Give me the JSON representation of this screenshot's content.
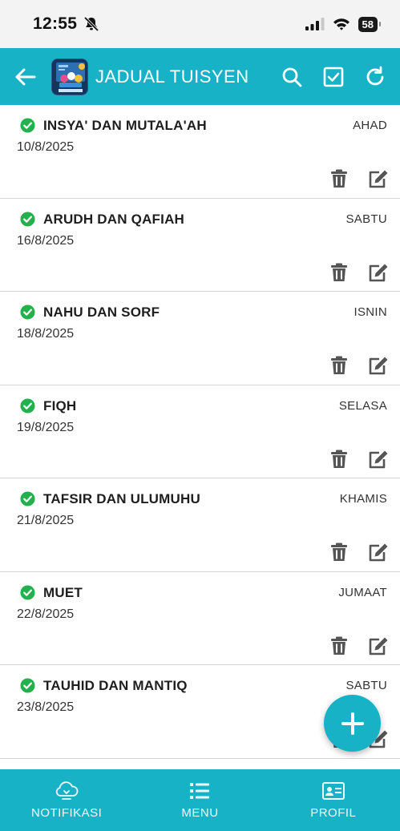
{
  "status_bar": {
    "time": "12:55",
    "battery": "58"
  },
  "app_bar": {
    "title": "JADUAL TUISYEN",
    "back_icon": "arrow-left-icon",
    "search_icon": "search-icon",
    "select_icon": "checkbox-icon",
    "refresh_icon": "refresh-icon"
  },
  "schedule": [
    {
      "subject": "INSYA' DAN MUTALA'AH",
      "day": "AHAD",
      "date": "10/8/2025"
    },
    {
      "subject": "ARUDH DAN QAFIAH",
      "day": "SABTU",
      "date": "16/8/2025"
    },
    {
      "subject": "NAHU DAN SORF",
      "day": "ISNIN",
      "date": "18/8/2025"
    },
    {
      "subject": "FIQH",
      "day": "SELASA",
      "date": "19/8/2025"
    },
    {
      "subject": "TAFSIR DAN ULUMUHU",
      "day": "KHAMIS",
      "date": "21/8/2025"
    },
    {
      "subject": "MUET",
      "day": "JUMAAT",
      "date": "22/8/2025"
    },
    {
      "subject": "TAUHID DAN MANTIQ",
      "day": "SABTU",
      "date": "23/8/2025"
    }
  ],
  "bottom_nav": {
    "items": [
      {
        "label": "NOTIFIKASI",
        "icon": "cloud-notification-icon"
      },
      {
        "label": "MENU",
        "icon": "list-icon"
      },
      {
        "label": "PROFIL",
        "icon": "id-card-icon"
      }
    ]
  },
  "colors": {
    "primary": "#18b2c7",
    "check": "#22b14c",
    "icon_gray": "#555555"
  }
}
